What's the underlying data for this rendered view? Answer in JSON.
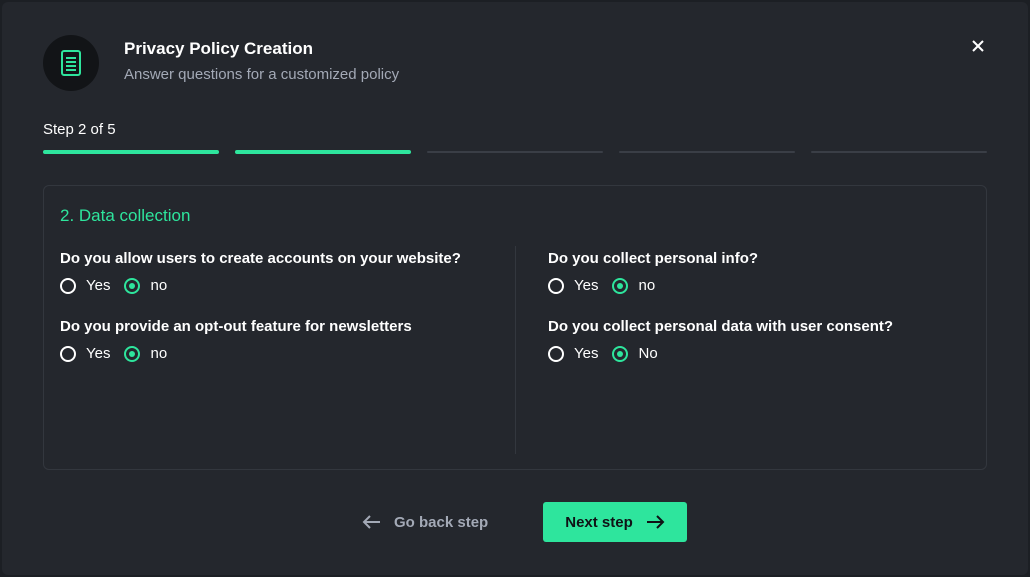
{
  "header": {
    "icon": "document-icon",
    "title": "Privacy Policy Creation",
    "subtitle": "Answer questions for a customized policy",
    "close_icon": "close-icon"
  },
  "progress": {
    "label": "Step 2 of 5",
    "current_step": 2,
    "total_steps": 5
  },
  "section": {
    "title": "2. Data collection",
    "questions": [
      {
        "text": "Do you allow users to create accounts on your website?",
        "options": [
          "Yes",
          "no"
        ],
        "selected": "no"
      },
      {
        "text": "Do you provide an opt-out feature for newsletters",
        "options": [
          "Yes",
          "no"
        ],
        "selected": "no"
      },
      {
        "text": "Do you collect personal info?",
        "options": [
          "Yes",
          "no"
        ],
        "selected": "no"
      },
      {
        "text": "Do you collect personal data with user consent?",
        "options": [
          "Yes",
          "No"
        ],
        "selected": "No"
      }
    ]
  },
  "footer": {
    "back_label": "Go back step",
    "next_label": "Next step"
  },
  "colors": {
    "accent": "#2ee59d",
    "background": "#24272d",
    "muted_text": "#a3a9b6"
  }
}
